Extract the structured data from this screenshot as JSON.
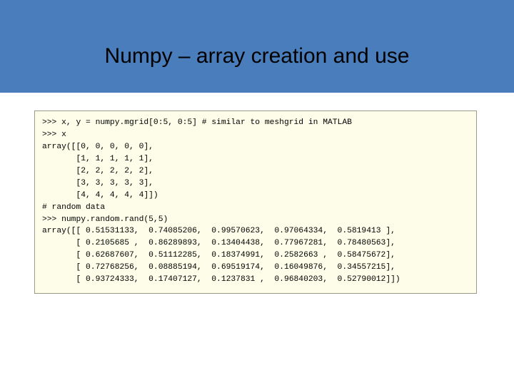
{
  "slide": {
    "title": "Numpy – array creation and use"
  },
  "code": {
    "lines": [
      ">>> x, y = numpy.mgrid[0:5, 0:5] # similar to meshgrid in MATLAB",
      ">>> x",
      "array([[0, 0, 0, 0, 0],",
      "       [1, 1, 1, 1, 1],",
      "       [2, 2, 2, 2, 2],",
      "       [3, 3, 3, 3, 3],",
      "       [4, 4, 4, 4, 4]])",
      "# random data",
      ">>> numpy.random.rand(5,5)",
      "array([[ 0.51531133,  0.74085206,  0.99570623,  0.97064334,  0.5819413 ],",
      "       [ 0.2105685 ,  0.86289893,  0.13404438,  0.77967281,  0.78480563],",
      "       [ 0.62687607,  0.51112285,  0.18374991,  0.2582663 ,  0.58475672],",
      "       [ 0.72768256,  0.08885194,  0.69519174,  0.16049876,  0.34557215],",
      "       [ 0.93724333,  0.17407127,  0.1237831 ,  0.96840203,  0.52790012]])"
    ]
  }
}
